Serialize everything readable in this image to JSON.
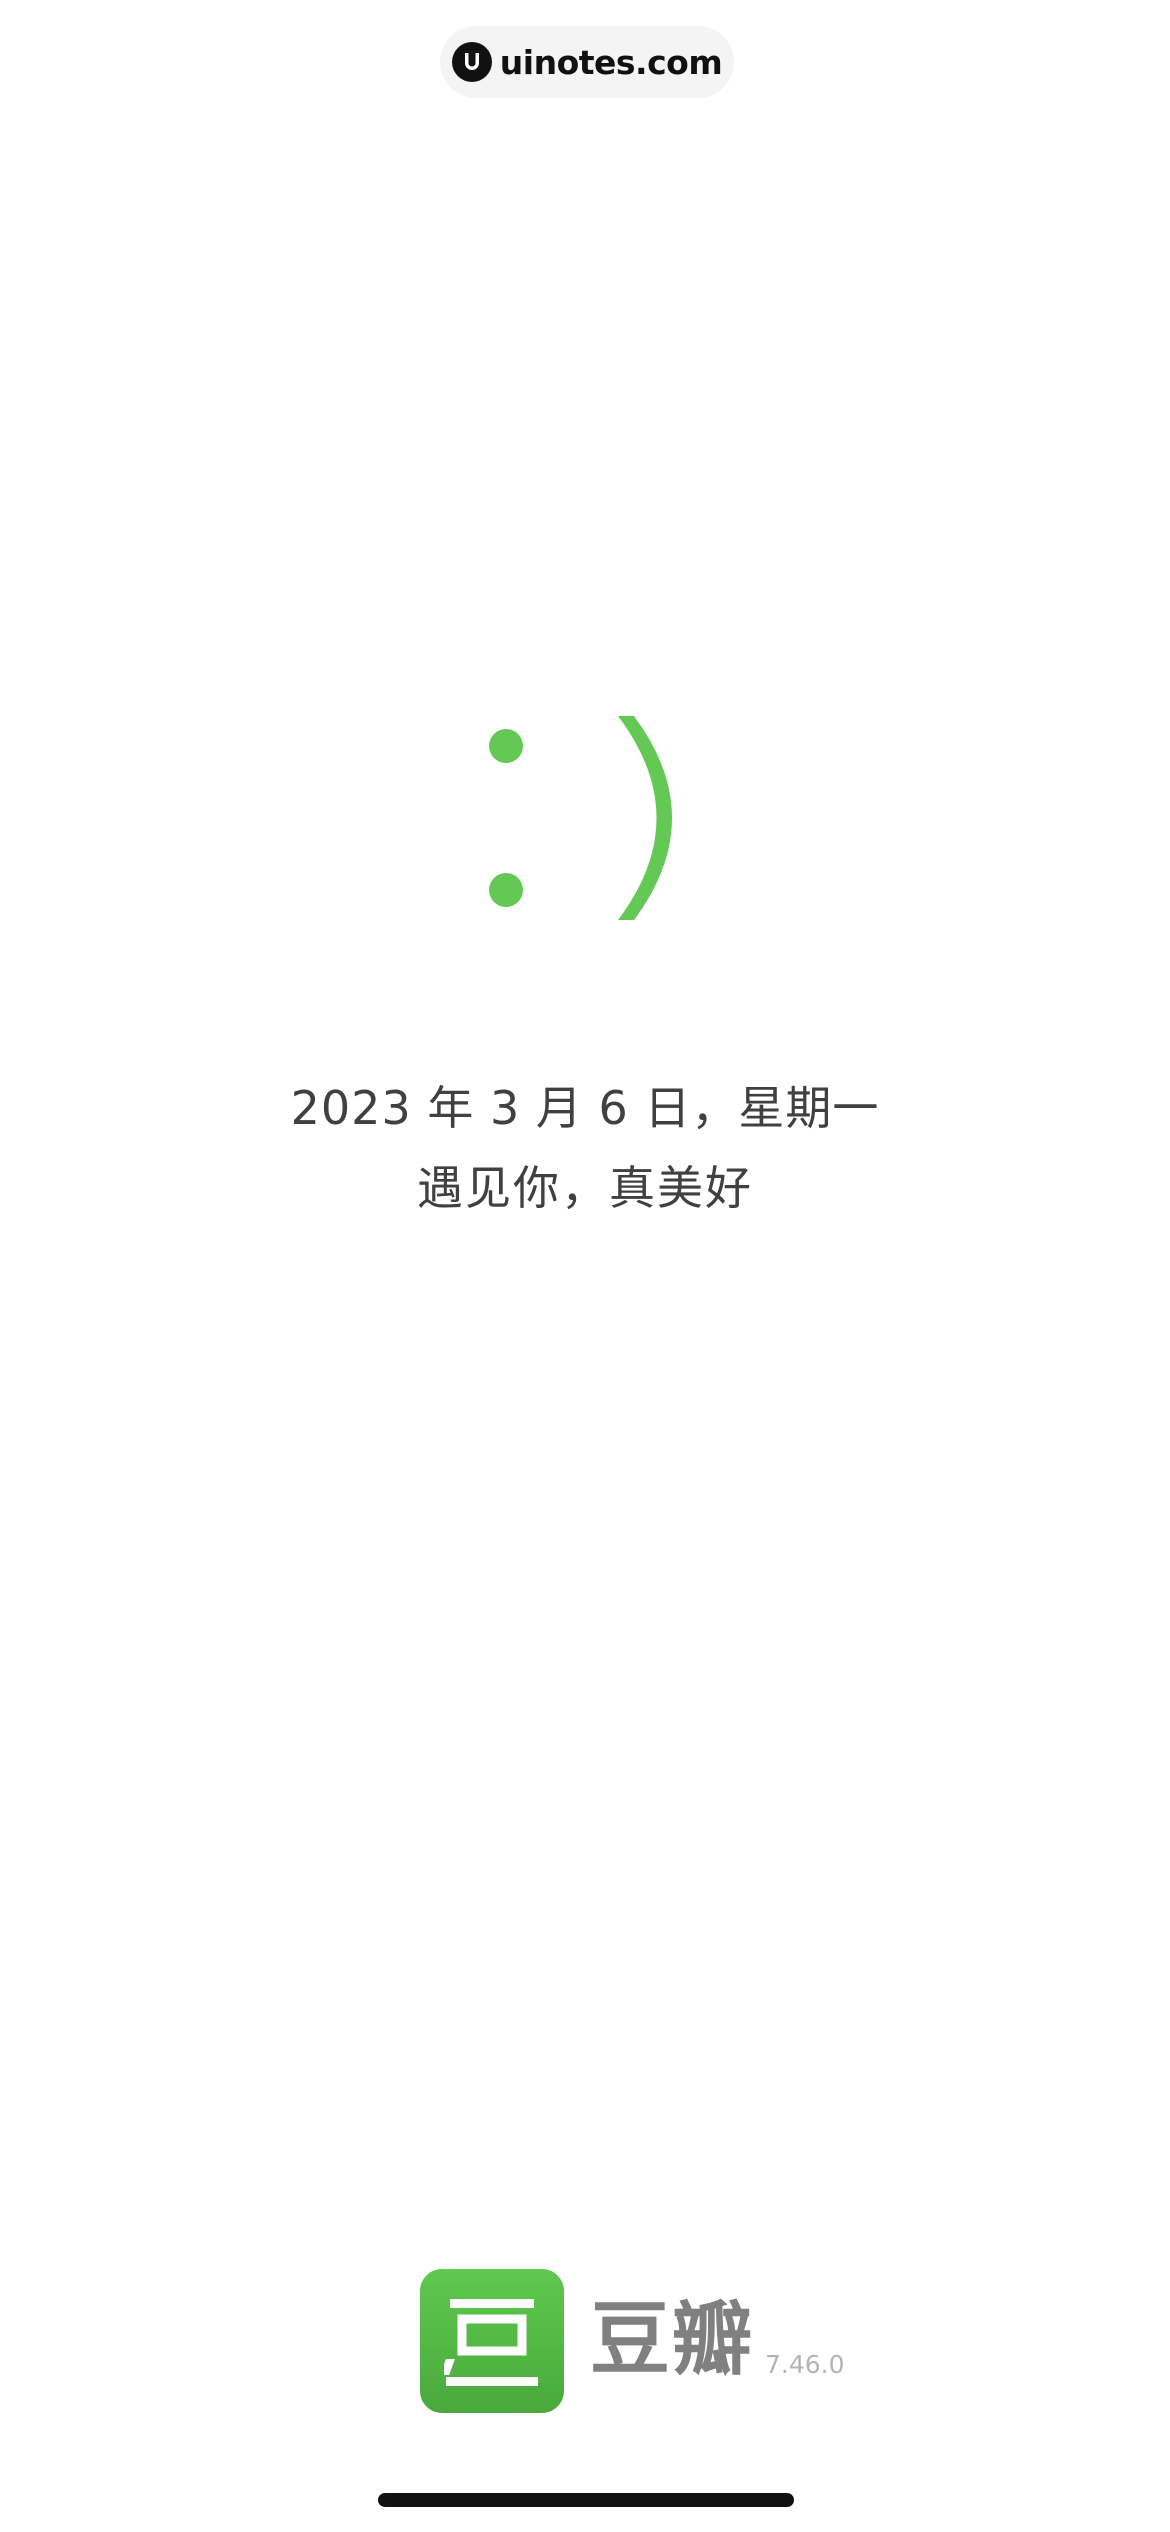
{
  "watermark": {
    "text": "uinotes.com",
    "icon": "uinotes-logo-icon"
  },
  "splash": {
    "emoticon": ":)",
    "date_text": "2023 年 3 月 6 日，星期一",
    "greeting": "遇见你，真美好"
  },
  "brand": {
    "icon": "douban-app-icon",
    "icon_glyph": "豆",
    "name": "豆瓣",
    "version": "7.46.0"
  },
  "colors": {
    "accent_green": "#63c854",
    "icon_green_top": "#5fc84f",
    "icon_green_bottom": "#49a93c",
    "text_dark": "#404040",
    "brand_gray": "#808080",
    "version_gray": "#b4b4b4"
  }
}
